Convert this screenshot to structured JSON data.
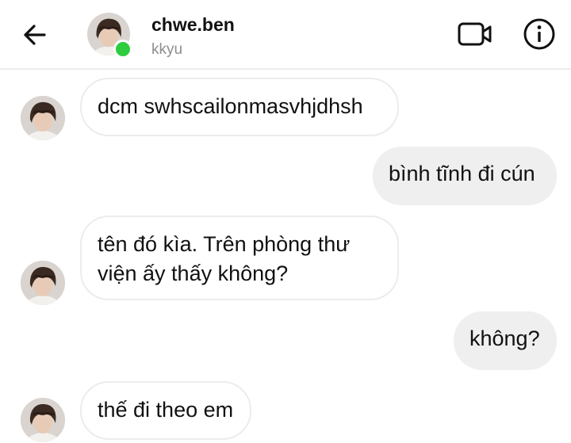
{
  "header": {
    "contact_name": "chwe.ben",
    "contact_username": "kkyu",
    "back_icon": "arrow-left-icon",
    "video_icon": "video-camera-icon",
    "info_icon": "info-icon"
  },
  "colors": {
    "online": "#2ecc3f",
    "outgoing_bubble": "#efefef",
    "incoming_border": "#ececec"
  },
  "messages": [
    {
      "direction": "incoming",
      "lines": [
        "dcm swhscailonmasvhjdhsh"
      ]
    },
    {
      "direction": "outgoing",
      "lines": [
        "bình tĩnh đi cún"
      ]
    },
    {
      "direction": "incoming",
      "lines": [
        "tên đó kìa. Trên phòng thư",
        "viện ấy thấy không?"
      ]
    },
    {
      "direction": "outgoing",
      "lines": [
        "không?"
      ]
    },
    {
      "direction": "incoming",
      "lines": [
        "thế đi theo em"
      ]
    }
  ]
}
